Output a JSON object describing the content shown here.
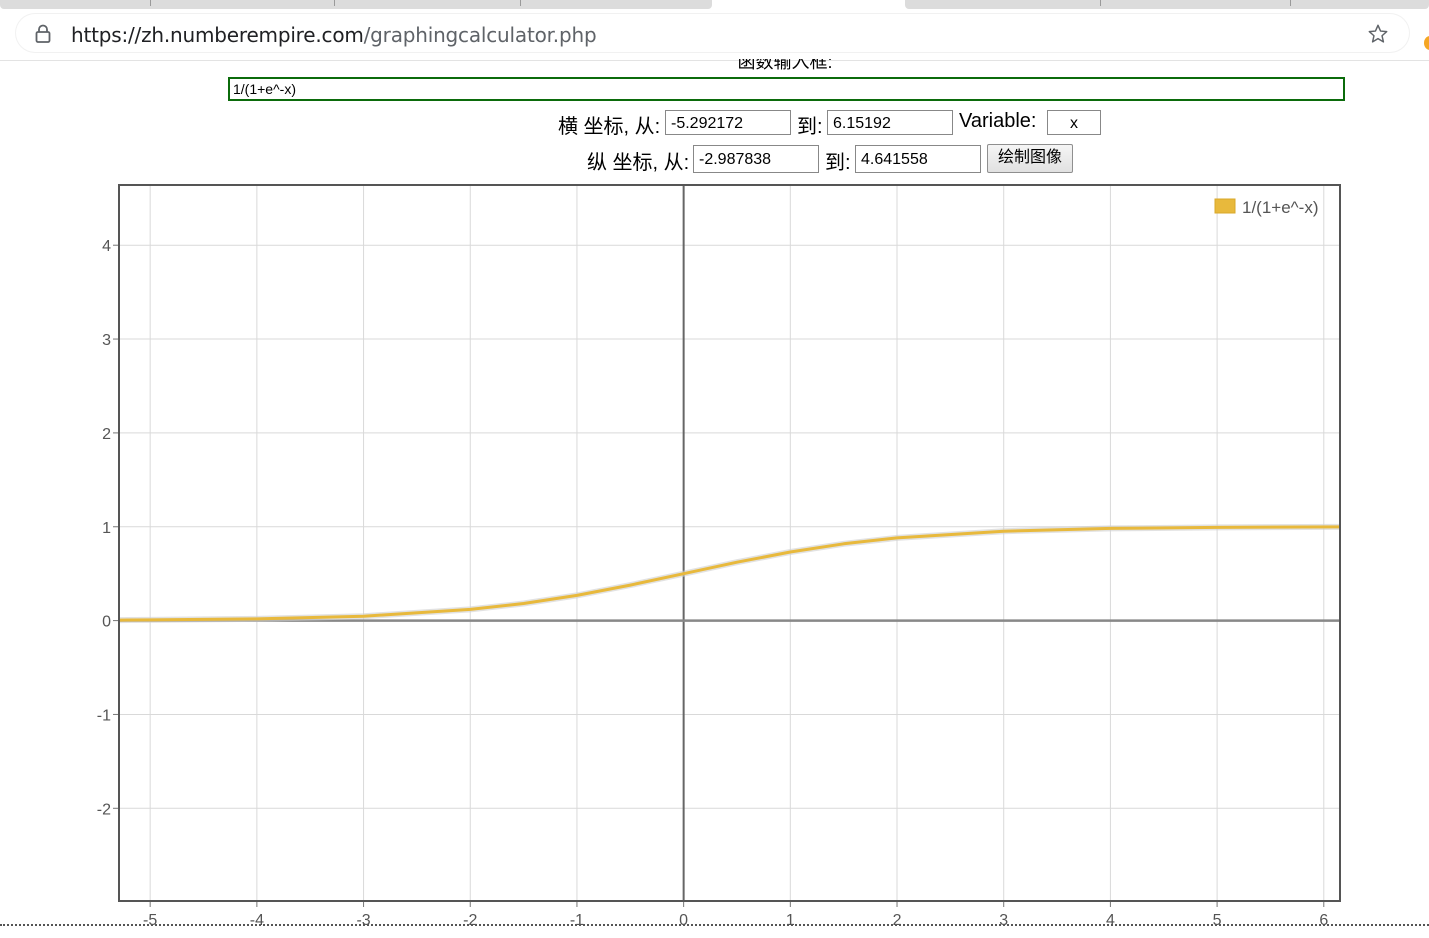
{
  "browser": {
    "url_host": "https://zh.numberempire.com",
    "url_path": "/graphingcalculator.php",
    "icons": [
      "lock-icon",
      "star-icon"
    ]
  },
  "form": {
    "function_label": "函数输入框:",
    "function_value": "1/(1+e^-x)",
    "x_from_label": "横 坐标, 从:",
    "x_from": "-5.292172",
    "x_to_label": "到:",
    "x_to": "6.15192",
    "variable_label": "Variable:",
    "variable": "x",
    "y_from_label": "纵 坐标, 从:",
    "y_from": "-2.987838",
    "y_to_label": "到:",
    "y_to": "4.641558",
    "plot_button": "绘制图像"
  },
  "chart_data": {
    "type": "line",
    "xlim": [
      -5.292172,
      6.15192
    ],
    "ylim": [
      -2.987838,
      4.641558
    ],
    "x_ticks": [
      "-5",
      "-4",
      "-3",
      "-2",
      "-1",
      "0",
      "1",
      "2",
      "3",
      "4",
      "5",
      "6"
    ],
    "y_ticks": [
      "4",
      "3",
      "2",
      "1",
      "0",
      "-1",
      "-2"
    ],
    "grid": true,
    "legend_position": "top-right",
    "series": [
      {
        "name": "1/(1+e^-x)",
        "color": "#e8b93c",
        "x": [
          -5.29,
          -5,
          -4,
          -3,
          -2,
          -1.5,
          -1,
          -0.5,
          0,
          0.5,
          1,
          1.5,
          2,
          3,
          4,
          5,
          6.15
        ],
        "y": [
          0.005,
          0.007,
          0.018,
          0.047,
          0.119,
          0.182,
          0.269,
          0.378,
          0.5,
          0.622,
          0.731,
          0.818,
          0.881,
          0.953,
          0.982,
          0.993,
          0.998
        ]
      }
    ]
  }
}
